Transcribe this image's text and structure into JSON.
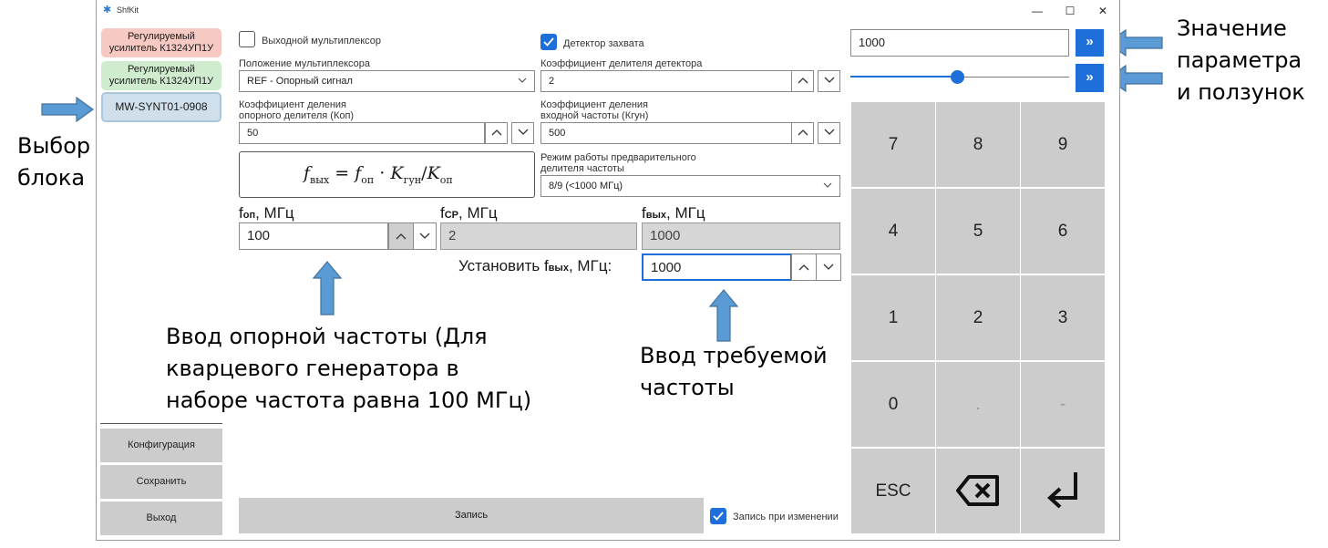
{
  "window": {
    "title": "ShfKit"
  },
  "sidebar": {
    "blocks": [
      {
        "line1": "Регулируемый",
        "line2": "усилитель К1324УП1У",
        "color": "#f6c9c2"
      },
      {
        "line1": "Регулируемый",
        "line2": "усилитель К1324УП1У",
        "color": "#cfeccf"
      },
      {
        "line1": "MW-SYNT01-0908",
        "color": "#cfe0ec"
      }
    ],
    "buttons": {
      "config": "Конфигурация",
      "save": "Сохранить",
      "exit": "Выход"
    }
  },
  "form": {
    "mux_output": {
      "label": "Выходной мультиплексор",
      "checked": false
    },
    "lock_detector": {
      "label": "Детектор захвата",
      "checked": true
    },
    "mux_position": {
      "label": "Положение мультиплексора",
      "value": "REF - Опорный сигнал"
    },
    "detector_divider": {
      "label": "Коэффициент делителя детектора",
      "value": "2"
    },
    "ref_divider": {
      "label_line1": "Коэффициент деления",
      "label_line2": "опорного делителя (Коп)",
      "value": "50"
    },
    "input_divider": {
      "label_line1": "Коэффициент деления",
      "label_line2": "входной частоты (Кгун)",
      "value": "500"
    },
    "prescaler_mode": {
      "label_line1": "Режим работы предварительного",
      "label_line2": "делителя частоты",
      "value": "8/9 (<1000 МГц)"
    },
    "formula": {
      "lhs": "f",
      "lhs_sub": "вых",
      "eq": "=",
      "f": "f",
      "f_sub": "оп",
      "dot": "·",
      "k1": "K",
      "k1_sub": "гун",
      "slash": "/",
      "k2": "K",
      "k2_sub": "оп"
    },
    "f_ref": {
      "label": "f",
      "label_sub": "оп",
      "unit": ", МГц",
      "value": "100"
    },
    "f_cmp": {
      "label": "f",
      "label_sub": "СР",
      "unit": ", МГц",
      "value": "2"
    },
    "f_out": {
      "label": "f",
      "label_sub": "вых",
      "unit": ", МГц",
      "value": "1000"
    },
    "set_f_out": {
      "label": "Установить f",
      "label_sub": "вых",
      "unit": ", МГц:",
      "value": "1000"
    },
    "write_button": "Запись",
    "write_on_change": {
      "label": "Запись при изменении",
      "checked": true
    }
  },
  "keypad": {
    "value": "1000",
    "slider_fraction": 0.49,
    "keys": [
      "7",
      "8",
      "9",
      "4",
      "5",
      "6",
      "1",
      "2",
      "3",
      "0",
      ".",
      "-",
      "ESC"
    ]
  },
  "annotations": {
    "right_line1": "Значение",
    "right_line2": "параметра",
    "right_line3": "и ползунок",
    "left_line1": "Выбор",
    "left_line2": "блока",
    "ref_line1": "Ввод опорной частоты (Для",
    "ref_line2": "кварцевого генератора в",
    "ref_line3": "наборе частота равна 100 МГц)",
    "req_line1": "Ввод требуемой",
    "req_line2": "частоты"
  },
  "colors": {
    "accent": "#1e6fd9",
    "arrow": "#5b9bd5"
  }
}
